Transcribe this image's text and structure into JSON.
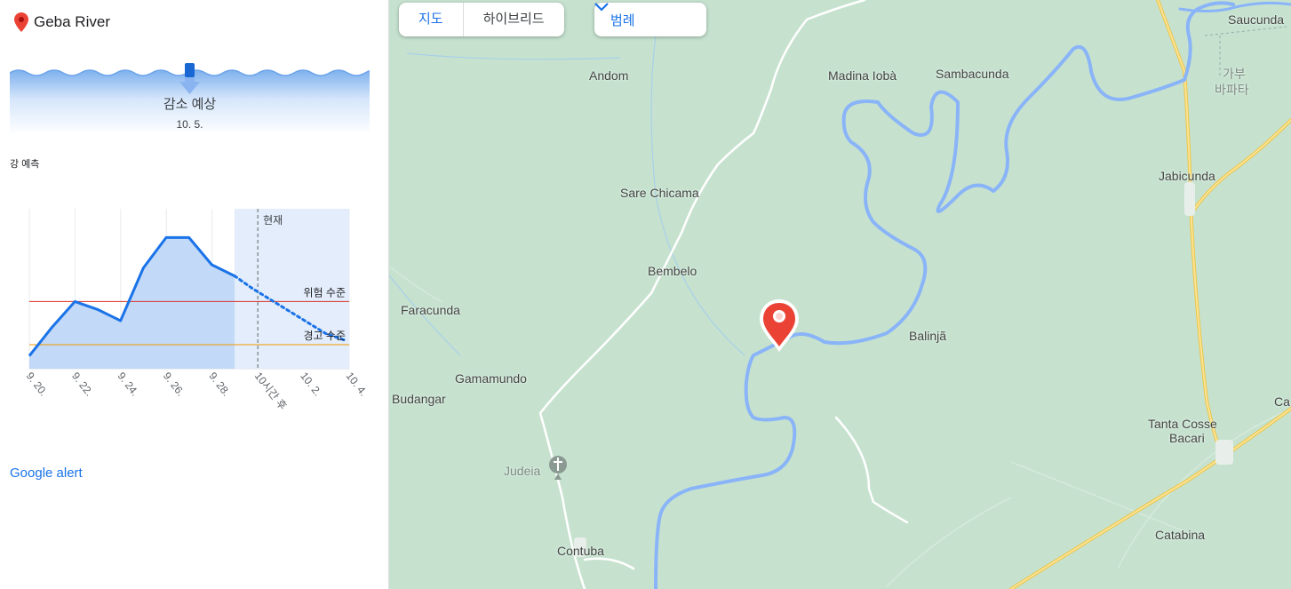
{
  "panel": {
    "river_name": "Geba River",
    "trend_label": "감소 예상",
    "trend_date": "10. 5.",
    "forecast_label": "강 예측",
    "alert_link": "Google alert"
  },
  "chart_data": {
    "type": "line",
    "x": [
      "9. 20.",
      "9. 22.",
      "9. 24.",
      "9. 26.",
      "9. 28.",
      "10시간 후",
      "10. 2.",
      "10. 4."
    ],
    "series": [
      {
        "values": [
          0.08,
          0.26,
          0.42,
          0.37,
          0.3,
          0.63,
          0.82,
          0.82,
          0.65,
          0.58
        ]
      },
      {
        "values": [
          0.58,
          0.5,
          0.43,
          0.36,
          0.29,
          0.22,
          0.18
        ]
      }
    ],
    "observed_count": 10,
    "forecast_count": 7,
    "now_label": "현재",
    "danger_label": "위험 수준",
    "danger_level": 0.42,
    "warning_label": "경고 수준",
    "warning_level": 0.15,
    "ylim": [
      0,
      1
    ],
    "colors": {
      "line": "#1a73e8",
      "fill": "#c2d9f7",
      "forecast_fill": "#e3edfb",
      "danger": "#d93025",
      "warning": "#f29900"
    }
  },
  "map": {
    "map_button": "지도",
    "hybrid_button": "하이브리드",
    "legend_button": "범례",
    "places": [
      "Saucunda",
      "가부",
      "바파타",
      "Andom",
      "Madina Iobà",
      "Sambacunda",
      "Jabicunda",
      "Sare Chicama",
      "Bembelo",
      "Faracunda",
      "Balinjã",
      "Gamamundo",
      "Budangar",
      "Tanta Cosse",
      "Bacari",
      "Ca",
      "Judeia",
      "Contuba",
      "Catabina"
    ],
    "icons": [
      "location-pin-icon",
      "chevron-down-icon",
      "cross-church-icon"
    ]
  }
}
